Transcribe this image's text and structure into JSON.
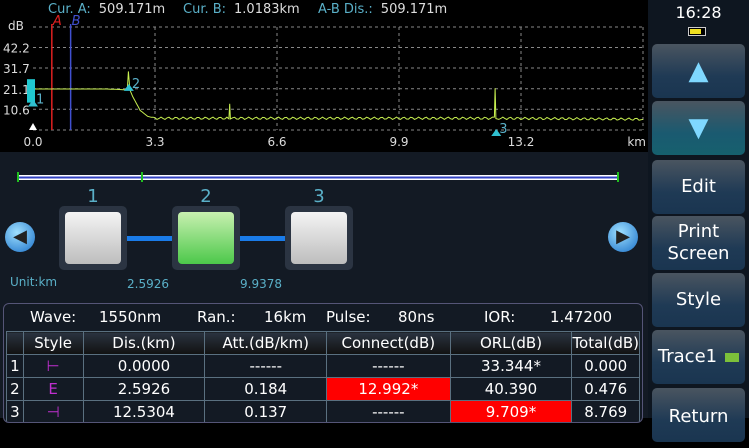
{
  "cursor": {
    "a_label": "Cur. A:",
    "a_value": "509.171m",
    "b_label": "Cur. B:",
    "b_value": "1.0183km",
    "ab_label": "A-B Dis.:",
    "ab_value": "509.171m"
  },
  "chart_data": {
    "type": "line",
    "ylabel": "dB",
    "xlabel": "km",
    "xticks": [
      "0.0",
      "3.3",
      "6.6",
      "9.9",
      "13.2"
    ],
    "yticks": [
      "42.2",
      "31.7",
      "21.1",
      "10.6"
    ],
    "xlim": [
      0,
      16.5
    ],
    "ylim": [
      0,
      52.7
    ],
    "grid": true,
    "cursor_a_km": 0.509,
    "cursor_b_km": 1.018,
    "cursor_a_label": "A",
    "cursor_b_label": "B",
    "trace_color": "#c8f050",
    "x": [
      0,
      0.05,
      2.0,
      2.55,
      2.58,
      2.62,
      2.7,
      2.9,
      3.1,
      3.3,
      5.3,
      5.32,
      5.34,
      5.4,
      12.48,
      12.5,
      12.52,
      12.6,
      16.5
    ],
    "y": [
      21,
      21,
      21,
      20.5,
      30,
      20.5,
      17,
      10,
      7,
      6,
      6,
      14,
      6,
      6,
      6,
      21,
      6,
      6,
      5.5
    ],
    "events": [
      {
        "label": "1",
        "km": 0
      },
      {
        "label": "2",
        "km": 2.5926
      },
      {
        "label": "3",
        "km": 12.5304
      }
    ]
  },
  "topology": {
    "nodes": [
      "1",
      "2",
      "3"
    ],
    "selected": 1,
    "unit": "Unit:km",
    "segments": [
      "2.5926",
      "9.9378"
    ]
  },
  "params": {
    "wave_label": "Wave:",
    "wave": "1550nm",
    "range_label": "Ran.:",
    "range": "16km",
    "pulse_label": "Pulse:",
    "pulse": "80ns",
    "ior_label": "IOR:",
    "ior": "1.47200"
  },
  "table": {
    "headers": [
      "",
      "Style",
      "Dis.(km)",
      "Att.(dB/km)",
      "Connect(dB)",
      "ORL(dB)",
      "Total(dB)"
    ],
    "rows": [
      {
        "n": "1",
        "style": "⊢",
        "dis": "0.0000",
        "att": "------",
        "con": "------",
        "orl": "33.344*",
        "tot": "0.000"
      },
      {
        "n": "2",
        "style": "E",
        "dis": "2.5926",
        "att": "0.184",
        "con": "12.992*",
        "orl": "40.390",
        "tot": "0.476"
      },
      {
        "n": "3",
        "style": "⊣",
        "dis": "12.5304",
        "att": "0.137",
        "con": "------",
        "orl": "9.709*",
        "tot": "8.769"
      }
    ],
    "alert_color": "#ff0000"
  },
  "side": {
    "time": "16:28",
    "battery": 0.7,
    "up_icon": "triangle-up-icon",
    "down_icon": "triangle-down-icon",
    "edit": "Edit",
    "print": "Print Screen",
    "style": "Style",
    "trace": "Trace1",
    "return": "Return"
  }
}
